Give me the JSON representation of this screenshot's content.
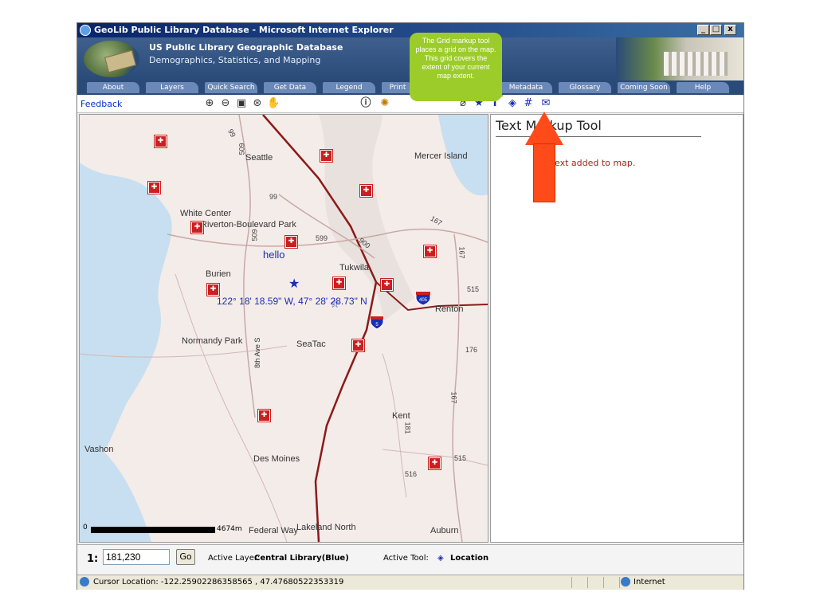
{
  "window": {
    "title": "GeoLib Public Library Database - Microsoft Internet Explorer",
    "min": "_",
    "max": "□",
    "close": "x"
  },
  "banner": {
    "title": "US Public Library Geographic Database",
    "subtitle": "Demographics, Statistics, and Mapping"
  },
  "nav": {
    "tabs": [
      "About",
      "Layers",
      "Quick Search",
      "Get Data",
      "Legend",
      "Print",
      "Metadata",
      "Glossary",
      "Coming Soon",
      "Help"
    ]
  },
  "toolbar": {
    "feedback": "Feedback",
    "icons": [
      "zoom-in-icon",
      "zoom-out-icon",
      "full-extent-icon",
      "zoom-active-icon",
      "pan-icon",
      "identify-icon",
      "measure-icon",
      "eraser-icon",
      "star-icon",
      "text-icon",
      "location-icon",
      "grid-icon",
      "mail-icon"
    ]
  },
  "map": {
    "places": [
      {
        "name": "Seattle"
      },
      {
        "name": "Mercer Island"
      },
      {
        "name": "White Center"
      },
      {
        "name": "Riverton-Boulevard Park"
      },
      {
        "name": "Tukwila"
      },
      {
        "name": "Burien"
      },
      {
        "name": "Renton"
      },
      {
        "name": "Normandy Park"
      },
      {
        "name": "SeaTac"
      },
      {
        "name": "Kent"
      },
      {
        "name": "Vashon"
      },
      {
        "name": "Des Moines"
      },
      {
        "name": "Federal Way"
      },
      {
        "name": "Lakeland North"
      },
      {
        "name": "Auburn"
      },
      {
        "name": "8th Ave S"
      }
    ],
    "road_numbers": [
      "99",
      "509",
      "99",
      "599",
      "900",
      "167",
      "515",
      "176",
      "167",
      "515",
      "516",
      "509",
      "167",
      "181"
    ],
    "hello_text": "hello",
    "coordinate_text": "122° 18' 18.59\" W, 47° 28' 28.73\" N",
    "scale_zero": "0",
    "scale_end": "4674m",
    "shield_405": "405",
    "shield_5": "5"
  },
  "panel": {
    "title": "Text Markup Tool",
    "message": "ext added to map."
  },
  "status": {
    "scale_prefix": "1:",
    "scale_value": "181,230",
    "go": "Go",
    "active_layer_label": "Active Layer:",
    "active_layer_value": "Central Library(Blue)",
    "active_tool_label": "Active Tool:",
    "active_tool_value": "Location"
  },
  "ie_status": {
    "cursor": "Cursor Location: -122.25902286358565 , 47.47680522353319",
    "zone": "Internet"
  },
  "callout": {
    "text": "The Grid markup tool places a grid on the map.  This grid covers the extent of your current map extent."
  },
  "colors": {
    "callout": "#9ccc2a",
    "arrow": "#ff4a1a",
    "library": "#cc1f1f",
    "markup_blue": "#1a2fb0"
  }
}
